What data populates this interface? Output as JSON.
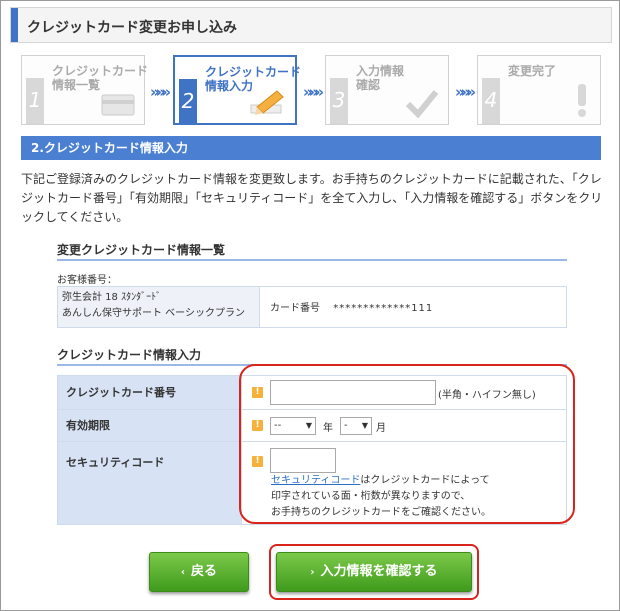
{
  "header": {
    "title": "クレジットカード変更お申し込み"
  },
  "steps": [
    {
      "num": "1",
      "label": "クレジットカード\n情報一覧"
    },
    {
      "num": "2",
      "label": "クレジットカード\n情報入力"
    },
    {
      "num": "3",
      "label": "入力情報\n確認"
    },
    {
      "num": "4",
      "label": "変更完了"
    }
  ],
  "arrows": "»»»",
  "section": {
    "title": "2.クレジットカード情報入力"
  },
  "description": "下記ご登録済みのクレジットカード情報を変更致します。お手持ちのクレジットカードに記載された、「クレジットカード番号」「有効期限」「セキュリティコード」を全て入力し、「入力情報を確認する」ボタンをクリックしてください。",
  "current_info": {
    "title": "変更クレジットカード情報一覧",
    "customer_label": "お客様番号：",
    "product": "弥生会計 18 ｽﾀﾝﾀﾞｰﾄﾞ\nあんしん保守サポート ベーシックプラン",
    "card_label": "カード番号",
    "card_value": "*************111"
  },
  "form": {
    "title": "クレジットカード情報入力",
    "required_mark": "!",
    "card_number": {
      "label": "クレジットカード番号",
      "value": "",
      "note": "(半角・ハイフン無し)"
    },
    "expiry": {
      "label": "有効期限",
      "month_value": "--",
      "year_unit": "年",
      "day_value": "-",
      "month_unit": "月"
    },
    "security": {
      "label": "セキュリティコード",
      "value": "",
      "help_link": "セキュリティコード",
      "help_text": "はクレジットカードによって\n印字されている面・桁数が異なりますので、\nお手持ちのクレジットカードをご確認ください。"
    }
  },
  "buttons": {
    "back_label": "戻る",
    "confirm_label": "入力情報を確認する",
    "chevron": "‹",
    "chevron_right": "›"
  },
  "colors": {
    "accent": "#3f73c4",
    "button_green": "#4caf2a",
    "highlight_red": "#d9241c",
    "required_orange": "#f6b13b"
  }
}
